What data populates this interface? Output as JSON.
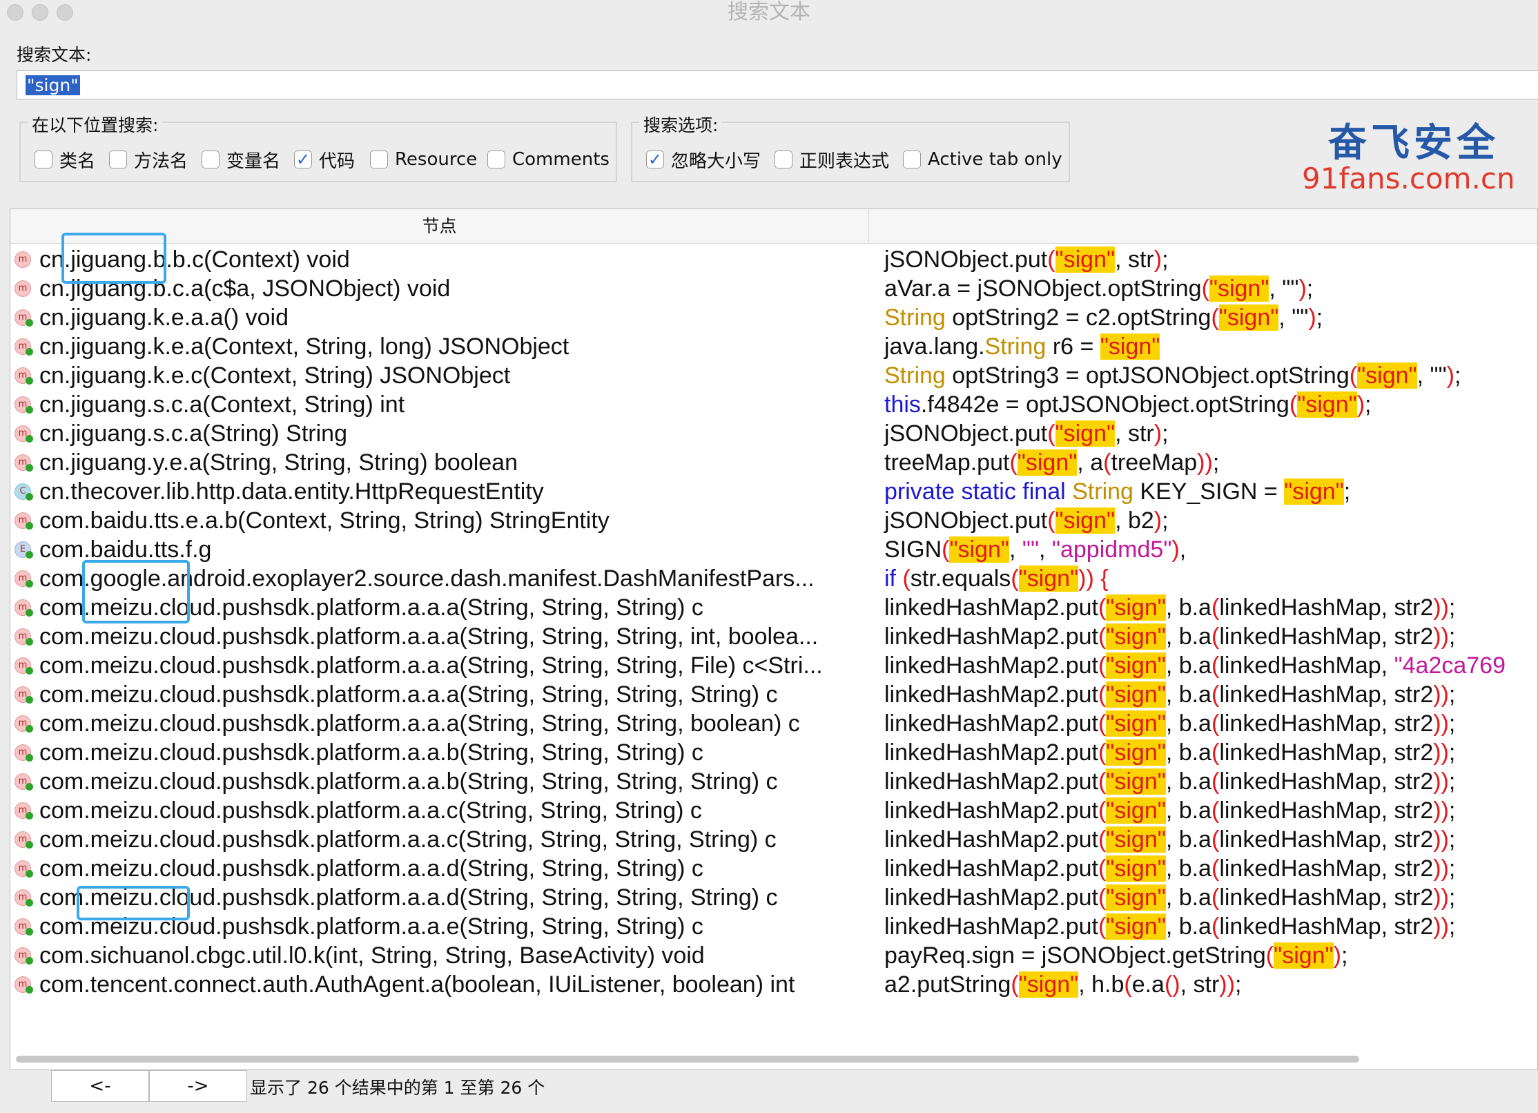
{
  "window": {
    "title": "搜索文本"
  },
  "search": {
    "label": "搜索文本:",
    "value": "\"sign\""
  },
  "location_group": {
    "title": "在以下位置搜索:",
    "options": [
      {
        "label": "类名",
        "checked": false
      },
      {
        "label": "方法名",
        "checked": false
      },
      {
        "label": "变量名",
        "checked": false
      },
      {
        "label": "代码",
        "checked": true
      },
      {
        "label": "Resource",
        "checked": false
      },
      {
        "label": "Comments",
        "checked": false
      }
    ]
  },
  "search_options_group": {
    "title": "搜索选项:",
    "options": [
      {
        "label": "忽略大小写",
        "checked": true
      },
      {
        "label": "正则表达式",
        "checked": false
      },
      {
        "label": "Active tab only",
        "checked": false
      }
    ]
  },
  "watermark": {
    "cn": "奋飞安全",
    "url": "91fans.com.cn"
  },
  "table": {
    "header_node": "节点",
    "header_code": "",
    "rows": [
      {
        "icon": "method-icon",
        "node": "cn.jiguang.b.b.c(Context) void",
        "code": [
          [
            "",
            "jSONObject.put"
          ],
          [
            "p",
            "("
          ],
          [
            "hl",
            "\"sign\""
          ],
          [
            "",
            ", str"
          ],
          [
            "p",
            ")"
          ],
          [
            "",
            ";"
          ]
        ]
      },
      {
        "icon": "method-icon",
        "node": "cn.jiguang.b.c.a(c$a, JSONObject) void",
        "code": [
          [
            "",
            "aVar.a = jSONObject.optString"
          ],
          [
            "p",
            "("
          ],
          [
            "hl",
            "\"sign\""
          ],
          [
            "",
            ", \"\""
          ],
          [
            "p",
            ")"
          ],
          [
            "",
            ";"
          ]
        ]
      },
      {
        "icon": "method-icon",
        "node": "cn.jiguang.k.e.a.a() void",
        "code": [
          [
            "t",
            "String"
          ],
          [
            "",
            " optString2 = c2.optString"
          ],
          [
            "p",
            "("
          ],
          [
            "hl",
            "\"sign\""
          ],
          [
            "",
            ", \"\""
          ],
          [
            "p",
            ")"
          ],
          [
            "",
            ";"
          ]
        ]
      },
      {
        "icon": "method-icon",
        "node": "cn.jiguang.k.e.a(Context, String, long) JSONObject",
        "code": [
          [
            "",
            "java.lang."
          ],
          [
            "t",
            "String"
          ],
          [
            "",
            " r6 = "
          ],
          [
            "hl",
            "\"sign\""
          ]
        ]
      },
      {
        "icon": "method-icon",
        "node": "cn.jiguang.k.e.c(Context, String) JSONObject",
        "code": [
          [
            "t",
            "String"
          ],
          [
            "",
            " optString3 = optJSONObject.optString"
          ],
          [
            "p",
            "("
          ],
          [
            "hl",
            "\"sign\""
          ],
          [
            "",
            ", \"\""
          ],
          [
            "p",
            ")"
          ],
          [
            "",
            ";"
          ]
        ]
      },
      {
        "icon": "method-icon",
        "node": "cn.jiguang.s.c.a(Context, String) int",
        "code": [
          [
            "k",
            "this"
          ],
          [
            "",
            ".f4842e = optJSONObject.optString"
          ],
          [
            "p",
            "("
          ],
          [
            "hl",
            "\"sign\""
          ],
          [
            "p",
            ")"
          ],
          [
            "",
            ";"
          ]
        ]
      },
      {
        "icon": "method-icon",
        "node": "cn.jiguang.s.c.a(String) String",
        "code": [
          [
            "",
            "jSONObject.put"
          ],
          [
            "p",
            "("
          ],
          [
            "hl",
            "\"sign\""
          ],
          [
            "",
            ", str"
          ],
          [
            "p",
            ")"
          ],
          [
            "",
            ";"
          ]
        ]
      },
      {
        "icon": "method-icon",
        "node": "cn.jiguang.y.e.a(String, String, String) boolean",
        "code": [
          [
            "",
            "treeMap.put"
          ],
          [
            "p",
            "("
          ],
          [
            "hl",
            "\"sign\""
          ],
          [
            "",
            ", a"
          ],
          [
            "p",
            "("
          ],
          [
            "",
            "treeMap"
          ],
          [
            "p",
            "))"
          ],
          [
            "",
            ";"
          ]
        ]
      },
      {
        "icon": "class-icon",
        "node": "cn.thecover.lib.http.data.entity.HttpRequestEntity",
        "code": [
          [
            "k",
            "private static final "
          ],
          [
            "t",
            "String"
          ],
          [
            "",
            " KEY_SIGN = "
          ],
          [
            "hl",
            "\"sign\""
          ],
          [
            "",
            ";"
          ]
        ]
      },
      {
        "icon": "method-icon",
        "node": "com.baidu.tts.e.a.b(Context, String, String) StringEntity",
        "code": [
          [
            "",
            "jSONObject.put"
          ],
          [
            "p",
            "("
          ],
          [
            "hl",
            "\"sign\""
          ],
          [
            "",
            ", b2"
          ],
          [
            "p",
            ")"
          ],
          [
            "",
            ";"
          ]
        ]
      },
      {
        "icon": "enum-icon",
        "node": "com.baidu.tts.f.g",
        "code": [
          [
            "",
            "SIGN"
          ],
          [
            "p",
            "("
          ],
          [
            "hl",
            "\"sign\""
          ],
          [
            "",
            ", "
          ],
          [
            "s",
            "\"\""
          ],
          [
            "",
            ", "
          ],
          [
            "s",
            "\"appidmd5\""
          ],
          [
            "p",
            ")"
          ],
          [
            "",
            ","
          ]
        ]
      },
      {
        "icon": "method-icon",
        "node": "com.google.android.exoplayer2.source.dash.manifest.DashManifestPars...",
        "code": [
          [
            "k",
            "if "
          ],
          [
            "p",
            "("
          ],
          [
            "",
            "str.equals"
          ],
          [
            "p",
            "("
          ],
          [
            "hl",
            "\"sign\""
          ],
          [
            "p",
            "))"
          ],
          [
            "",
            " "
          ],
          [
            "p",
            "{"
          ]
        ]
      },
      {
        "icon": "method-icon",
        "node": "com.meizu.cloud.pushsdk.platform.a.a.a(String, String, String) c",
        "code": [
          [
            "",
            "linkedHashMap2.put"
          ],
          [
            "p",
            "("
          ],
          [
            "hl",
            "\"sign\""
          ],
          [
            "",
            ", b.a"
          ],
          [
            "p",
            "("
          ],
          [
            "",
            "linkedHashMap, str2"
          ],
          [
            "p",
            "))"
          ],
          [
            "",
            ";"
          ]
        ]
      },
      {
        "icon": "method-icon",
        "node": "com.meizu.cloud.pushsdk.platform.a.a.a(String, String, String, int, boolea...",
        "code": [
          [
            "",
            "linkedHashMap2.put"
          ],
          [
            "p",
            "("
          ],
          [
            "hl",
            "\"sign\""
          ],
          [
            "",
            ", b.a"
          ],
          [
            "p",
            "("
          ],
          [
            "",
            "linkedHashMap, str2"
          ],
          [
            "p",
            "))"
          ],
          [
            "",
            ";"
          ]
        ]
      },
      {
        "icon": "method-icon",
        "node": "com.meizu.cloud.pushsdk.platform.a.a.a(String, String, String, File) c<Stri...",
        "code": [
          [
            "",
            "linkedHashMap2.put"
          ],
          [
            "p",
            "("
          ],
          [
            "hl",
            "\"sign\""
          ],
          [
            "",
            ", b.a"
          ],
          [
            "p",
            "("
          ],
          [
            "",
            "linkedHashMap, "
          ],
          [
            "s",
            "\"4a2ca769"
          ]
        ]
      },
      {
        "icon": "method-icon",
        "node": "com.meizu.cloud.pushsdk.platform.a.a.a(String, String, String, String) c",
        "code": [
          [
            "",
            "linkedHashMap2.put"
          ],
          [
            "p",
            "("
          ],
          [
            "hl",
            "\"sign\""
          ],
          [
            "",
            ", b.a"
          ],
          [
            "p",
            "("
          ],
          [
            "",
            "linkedHashMap, str2"
          ],
          [
            "p",
            "))"
          ],
          [
            "",
            ";"
          ]
        ]
      },
      {
        "icon": "method-icon",
        "node": "com.meizu.cloud.pushsdk.platform.a.a.a(String, String, String, boolean) c",
        "code": [
          [
            "",
            "linkedHashMap2.put"
          ],
          [
            "p",
            "("
          ],
          [
            "hl",
            "\"sign\""
          ],
          [
            "",
            ", b.a"
          ],
          [
            "p",
            "("
          ],
          [
            "",
            "linkedHashMap, str2"
          ],
          [
            "p",
            "))"
          ],
          [
            "",
            ";"
          ]
        ]
      },
      {
        "icon": "method-icon",
        "node": "com.meizu.cloud.pushsdk.platform.a.a.b(String, String, String) c",
        "code": [
          [
            "",
            "linkedHashMap2.put"
          ],
          [
            "p",
            "("
          ],
          [
            "hl",
            "\"sign\""
          ],
          [
            "",
            ", b.a"
          ],
          [
            "p",
            "("
          ],
          [
            "",
            "linkedHashMap, str2"
          ],
          [
            "p",
            "))"
          ],
          [
            "",
            ";"
          ]
        ]
      },
      {
        "icon": "method-icon",
        "node": "com.meizu.cloud.pushsdk.platform.a.a.b(String, String, String, String) c",
        "code": [
          [
            "",
            "linkedHashMap2.put"
          ],
          [
            "p",
            "("
          ],
          [
            "hl",
            "\"sign\""
          ],
          [
            "",
            ", b.a"
          ],
          [
            "p",
            "("
          ],
          [
            "",
            "linkedHashMap, str2"
          ],
          [
            "p",
            "))"
          ],
          [
            "",
            ";"
          ]
        ]
      },
      {
        "icon": "method-icon",
        "node": "com.meizu.cloud.pushsdk.platform.a.a.c(String, String, String) c",
        "code": [
          [
            "",
            "linkedHashMap2.put"
          ],
          [
            "p",
            "("
          ],
          [
            "hl",
            "\"sign\""
          ],
          [
            "",
            ", b.a"
          ],
          [
            "p",
            "("
          ],
          [
            "",
            "linkedHashMap, str2"
          ],
          [
            "p",
            "))"
          ],
          [
            "",
            ";"
          ]
        ]
      },
      {
        "icon": "method-icon",
        "node": "com.meizu.cloud.pushsdk.platform.a.a.c(String, String, String, String) c",
        "code": [
          [
            "",
            "linkedHashMap2.put"
          ],
          [
            "p",
            "("
          ],
          [
            "hl",
            "\"sign\""
          ],
          [
            "",
            ", b.a"
          ],
          [
            "p",
            "("
          ],
          [
            "",
            "linkedHashMap, str2"
          ],
          [
            "p",
            "))"
          ],
          [
            "",
            ";"
          ]
        ]
      },
      {
        "icon": "method-icon",
        "node": "com.meizu.cloud.pushsdk.platform.a.a.d(String, String, String) c",
        "code": [
          [
            "",
            "linkedHashMap2.put"
          ],
          [
            "p",
            "("
          ],
          [
            "hl",
            "\"sign\""
          ],
          [
            "",
            ", b.a"
          ],
          [
            "p",
            "("
          ],
          [
            "",
            "linkedHashMap, str2"
          ],
          [
            "p",
            "))"
          ],
          [
            "",
            ";"
          ]
        ]
      },
      {
        "icon": "method-icon",
        "node": "com.meizu.cloud.pushsdk.platform.a.a.d(String, String, String, String) c",
        "code": [
          [
            "",
            "linkedHashMap2.put"
          ],
          [
            "p",
            "("
          ],
          [
            "hl",
            "\"sign\""
          ],
          [
            "",
            ", b.a"
          ],
          [
            "p",
            "("
          ],
          [
            "",
            "linkedHashMap, str2"
          ],
          [
            "p",
            "))"
          ],
          [
            "",
            ";"
          ]
        ]
      },
      {
        "icon": "method-icon",
        "node": "com.meizu.cloud.pushsdk.platform.a.a.e(String, String, String) c",
        "code": [
          [
            "",
            "linkedHashMap2.put"
          ],
          [
            "p",
            "("
          ],
          [
            "hl",
            "\"sign\""
          ],
          [
            "",
            ", b.a"
          ],
          [
            "p",
            "("
          ],
          [
            "",
            "linkedHashMap, str2"
          ],
          [
            "p",
            "))"
          ],
          [
            "",
            ";"
          ]
        ]
      },
      {
        "icon": "method-icon",
        "node": "com.sichuanol.cbgc.util.l0.k(int, String, String, BaseActivity) void",
        "code": [
          [
            "",
            "payReq.sign = jSONObject.getString"
          ],
          [
            "p",
            "("
          ],
          [
            "hl",
            "\"sign\""
          ],
          [
            "p",
            ")"
          ],
          [
            "",
            ";"
          ]
        ]
      },
      {
        "icon": "method-icon",
        "node": "com.tencent.connect.auth.AuthAgent.a(boolean, IUiListener, boolean) int",
        "code": [
          [
            "",
            "a2.putString"
          ],
          [
            "p",
            "("
          ],
          [
            "hl",
            "\"sign\""
          ],
          [
            "",
            ", h.b"
          ],
          [
            "p",
            "("
          ],
          [
            "",
            "e.a"
          ],
          [
            "p",
            "()"
          ],
          [
            "",
            ", str"
          ],
          [
            "p",
            "))"
          ],
          [
            "",
            ";"
          ]
        ]
      }
    ]
  },
  "nav": {
    "prev": "<-",
    "next": "->"
  },
  "status": "显示了 26 个结果中的第 1 至第 26 个",
  "colors": {
    "keyword": "#1c18d4",
    "type": "#c28f00",
    "string": "#c2189a",
    "paren": "#e1181c",
    "highlight": "#fbd400",
    "selection": "#2b63c7",
    "annotation_box": "#3aa9ea"
  }
}
